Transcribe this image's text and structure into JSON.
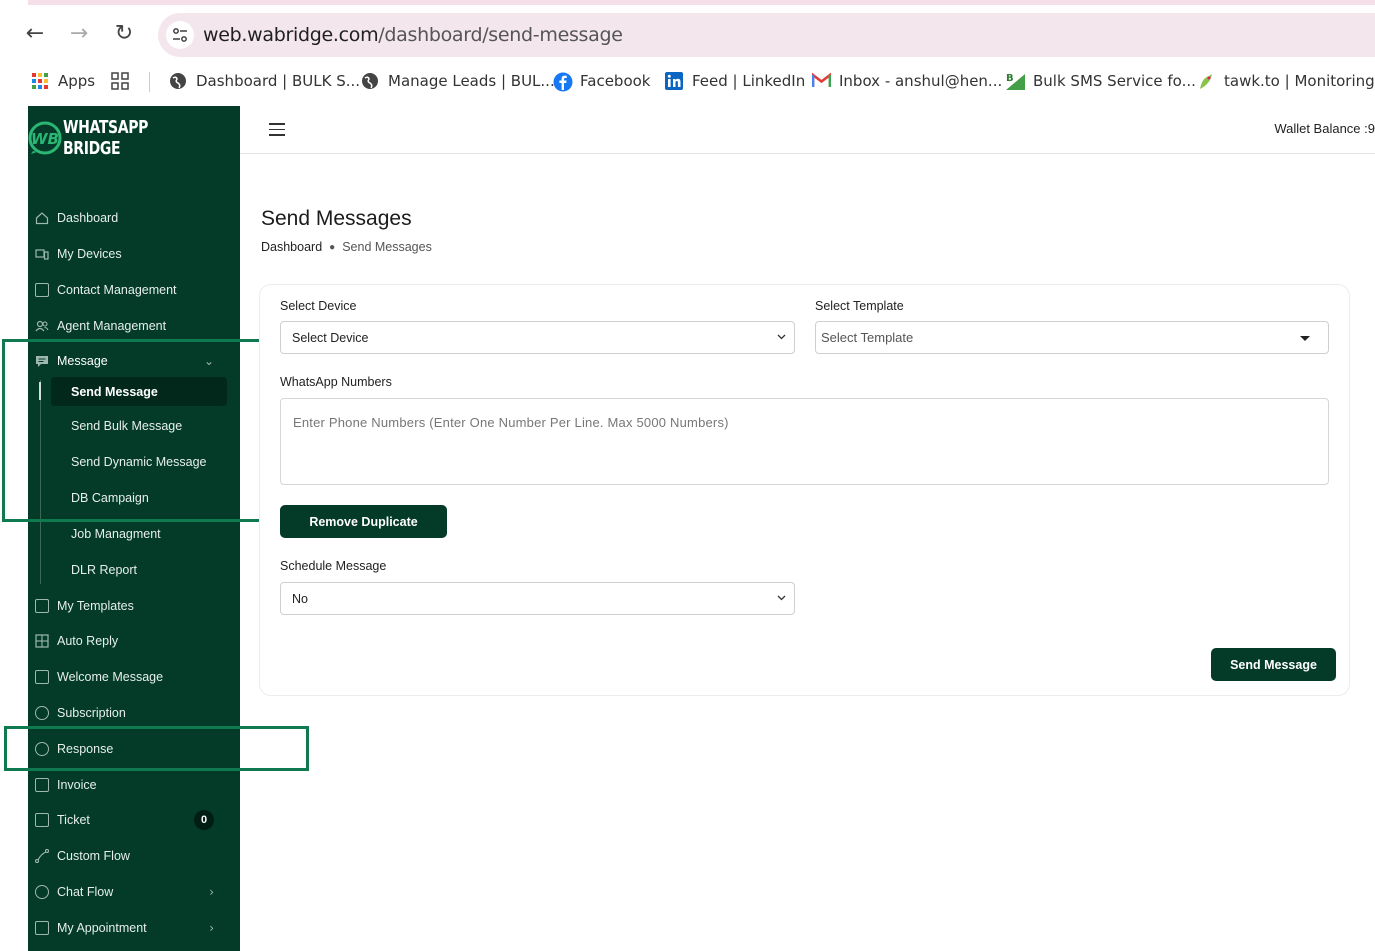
{
  "browser": {
    "url_domain": "web.wabridge.com",
    "url_path": "/dashboard/send-message",
    "bookmarks": [
      {
        "label": "Apps",
        "icon": "apps-grid-icon"
      },
      {
        "label": "",
        "icon": "tab-groups-icon"
      },
      {
        "label": "Dashboard | BULK S...",
        "icon": "globe-icon"
      },
      {
        "label": "Manage Leads | BUL...",
        "icon": "globe-icon"
      },
      {
        "label": "Facebook",
        "icon": "facebook-icon"
      },
      {
        "label": "Feed | LinkedIn",
        "icon": "linkedin-icon"
      },
      {
        "label": "Inbox - anshul@hen...",
        "icon": "gmail-icon"
      },
      {
        "label": "Bulk SMS Service fo...",
        "icon": "bulk-sms-icon"
      },
      {
        "label": "tawk.to | Monitoring",
        "icon": "tawk-icon"
      }
    ]
  },
  "brand": {
    "name": "WHATSAPP BRIDGE",
    "accent": "#033a28",
    "highlight": "#0f7a4f"
  },
  "sidebar": {
    "items": [
      {
        "label": "Dashboard",
        "icon": "home-icon"
      },
      {
        "label": "My Devices",
        "icon": "devices-icon"
      },
      {
        "label": "Contact Management",
        "icon": "contact-icon"
      },
      {
        "label": "Agent Management",
        "icon": "users-icon"
      },
      {
        "label": "Message",
        "icon": "message-icon"
      },
      {
        "label": "My Templates",
        "icon": "template-icon"
      },
      {
        "label": "Auto Reply",
        "icon": "auto-reply-icon"
      },
      {
        "label": "Welcome Message",
        "icon": "welcome-icon"
      },
      {
        "label": "Subscription",
        "icon": "subscription-icon"
      },
      {
        "label": "Response",
        "icon": "response-icon"
      },
      {
        "label": "Invoice",
        "icon": "invoice-icon"
      },
      {
        "label": "Ticket",
        "icon": "ticket-icon",
        "badge": "0"
      },
      {
        "label": "Custom Flow",
        "icon": "flow-icon"
      },
      {
        "label": "Chat Flow",
        "icon": "chat-icon"
      },
      {
        "label": "My Appointment",
        "icon": "calendar-icon"
      }
    ],
    "message_sub": [
      {
        "label": "Send Message"
      },
      {
        "label": "Send Bulk Message"
      },
      {
        "label": "Send Dynamic Message"
      },
      {
        "label": "DB Campaign"
      },
      {
        "label": "Job Managment"
      },
      {
        "label": "DLR Report"
      }
    ]
  },
  "topbar": {
    "wallet": "Wallet Balance :9"
  },
  "page": {
    "title": "Send Messages",
    "breadcrumb": {
      "home": "Dashboard",
      "current": "Send Messages"
    }
  },
  "form": {
    "device_label": "Select Device",
    "device_value": "Select Device",
    "template_label": "Select Template",
    "template_value": "Select Template",
    "numbers_label": "WhatsApp Numbers",
    "numbers_placeholder": "Enter Phone Numbers (Enter One Number Per Line. Max 5000 Numbers)",
    "remove_duplicate": "Remove Duplicate",
    "schedule_label": "Schedule Message",
    "schedule_value": "No",
    "send_button": "Send Message"
  }
}
